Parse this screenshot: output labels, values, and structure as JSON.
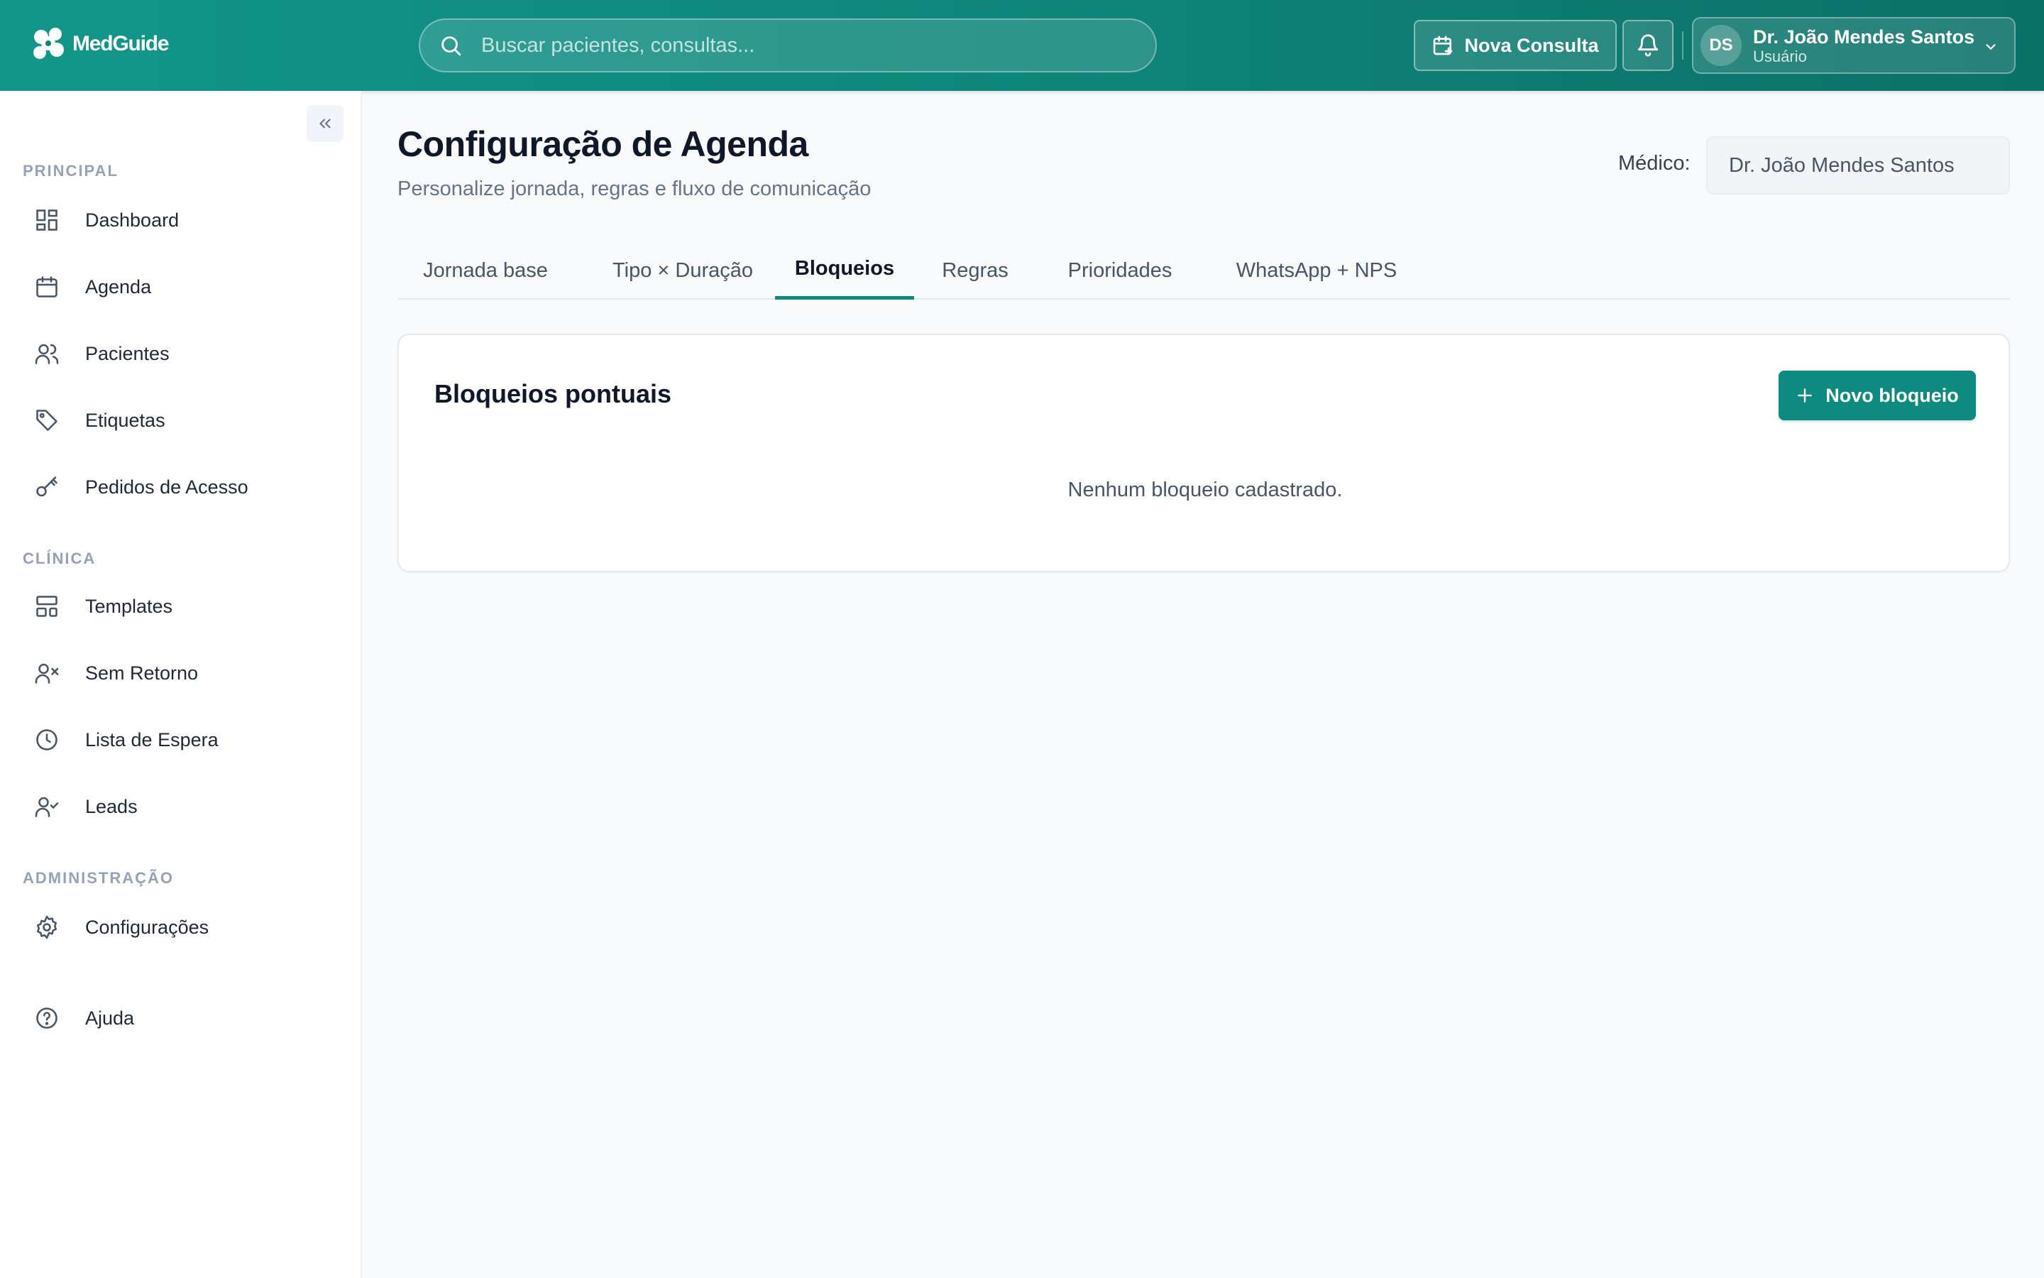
{
  "app": {
    "name": "MedGuide"
  },
  "header": {
    "search_placeholder": "Buscar pacientes, consultas...",
    "new_appointment_label": "Nova Consulta",
    "user": {
      "initials": "DS",
      "name": "Dr. João Mendes Santos",
      "role": "Usuário"
    }
  },
  "sidebar": {
    "sections": [
      {
        "label": "PRINCIPAL"
      },
      {
        "label": "CLÍNICA"
      },
      {
        "label": "ADMINISTRAÇÃO"
      }
    ],
    "items": [
      {
        "label": "Dashboard",
        "icon": "dashboard-icon"
      },
      {
        "label": "Agenda",
        "icon": "calendar-icon"
      },
      {
        "label": "Pacientes",
        "icon": "users-icon"
      },
      {
        "label": "Etiquetas",
        "icon": "tag-icon"
      },
      {
        "label": "Pedidos de Acesso",
        "icon": "key-icon"
      },
      {
        "label": "Templates",
        "icon": "template-icon"
      },
      {
        "label": "Sem Retorno",
        "icon": "user-x-icon"
      },
      {
        "label": "Lista de Espera",
        "icon": "clock-icon"
      },
      {
        "label": "Leads",
        "icon": "user-check-icon"
      },
      {
        "label": "Configurações",
        "icon": "gear-icon"
      },
      {
        "label": "Ajuda",
        "icon": "help-icon"
      }
    ]
  },
  "page": {
    "title": "Configuração de Agenda",
    "subtitle": "Personalize jornada, regras e fluxo de comunicação",
    "doctor_label": "Médico:",
    "doctor_value": "Dr. João Mendes Santos"
  },
  "tabs": [
    {
      "label": "Jornada base"
    },
    {
      "label": "Tipo × Duração"
    },
    {
      "label": "Bloqueios"
    },
    {
      "label": "Regras"
    },
    {
      "label": "Prioridades"
    },
    {
      "label": "WhatsApp + NPS"
    }
  ],
  "active_tab": "Bloqueios",
  "card": {
    "title": "Bloqueios pontuais",
    "add_button_label": "Novo bloqueio",
    "empty_message": "Nenhum bloqueio cadastrado."
  },
  "colors": {
    "brand": "#0f8a80",
    "header_start": "#12968a",
    "header_end": "#0b7068"
  }
}
